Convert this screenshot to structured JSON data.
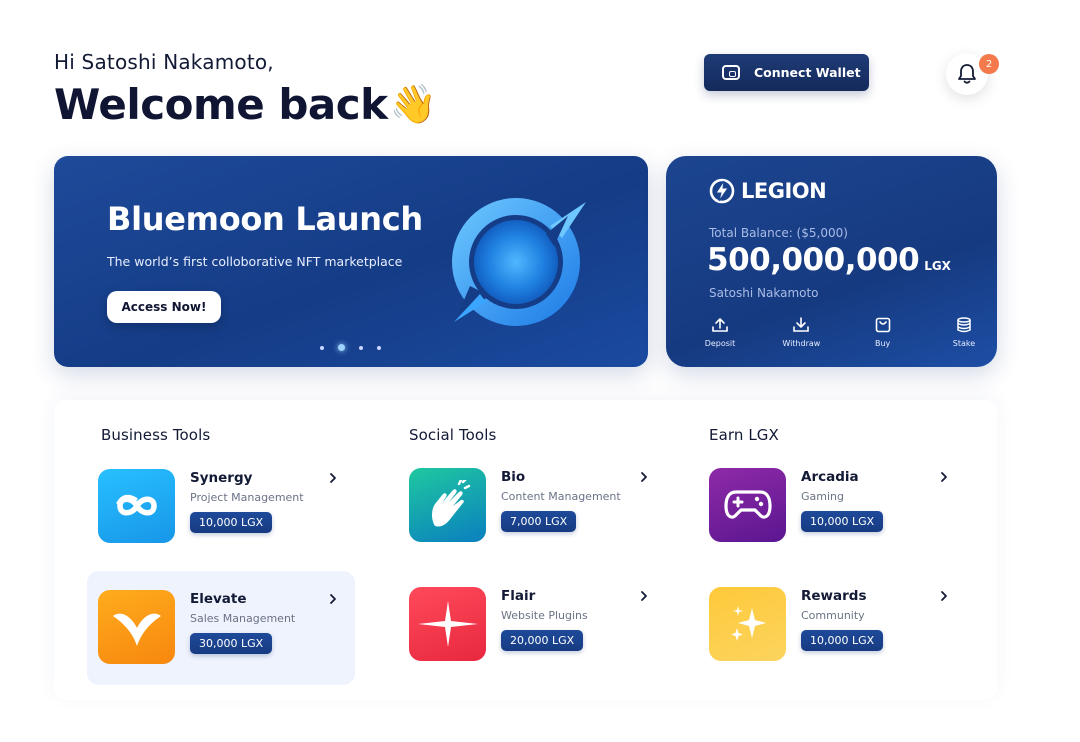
{
  "header": {
    "greeting": "Hi Satoshi Nakamoto,",
    "welcome": "Welcome back",
    "wave": "👋",
    "connect_wallet_label": "Connect Wallet",
    "notification_count": "2"
  },
  "hero": {
    "title": "Bluemoon Launch",
    "subtitle": "The world’s first colloborative NFT marketplace",
    "cta_label": "Access Now!",
    "slide_count": 4,
    "active_slide": 2
  },
  "wallet": {
    "brand": "LEGION",
    "balance_label": "Total Balance:  ($5,000)",
    "balance_value": "500,000,000",
    "balance_unit": "LGX",
    "owner": "Satoshi Nakamoto",
    "actions": [
      {
        "label": "Deposit",
        "icon": "upload-icon"
      },
      {
        "label": "Withdraw",
        "icon": "download-icon"
      },
      {
        "label": "Buy",
        "icon": "shopping-bag-icon"
      },
      {
        "label": "Stake",
        "icon": "coin-stack-icon"
      }
    ]
  },
  "sections": [
    {
      "title": "Business Tools",
      "items": [
        {
          "name": "Synergy",
          "category": "Project Management",
          "price": "10,000 LGX",
          "icon": "infinity-icon",
          "color": "#1aa7f0"
        },
        {
          "name": "Elevate",
          "category": "Sales Management",
          "price": "30,000 LGX",
          "icon": "wings-icon",
          "color": "#f79a12",
          "selected": true
        }
      ]
    },
    {
      "title": "Social Tools",
      "items": [
        {
          "name": "Bio",
          "category": "Content Management",
          "price": "7,000 LGX",
          "icon": "snap-hand-icon",
          "color": "#10b59a"
        },
        {
          "name": "Flair",
          "category": "Website Plugins",
          "price": "20,000 LGX",
          "icon": "sparkle-star-icon",
          "color": "#f0364f"
        }
      ]
    },
    {
      "title": "Earn LGX",
      "items": [
        {
          "name": "Arcadia",
          "category": "Gaming",
          "price": "10,000 LGX",
          "icon": "gamepad-icon",
          "color": "#7b1fa0"
        },
        {
          "name": "Rewards",
          "category": "Community",
          "price": "10,000 LGX",
          "icon": "sparkles-icon",
          "color": "#fbc223"
        }
      ]
    }
  ]
}
